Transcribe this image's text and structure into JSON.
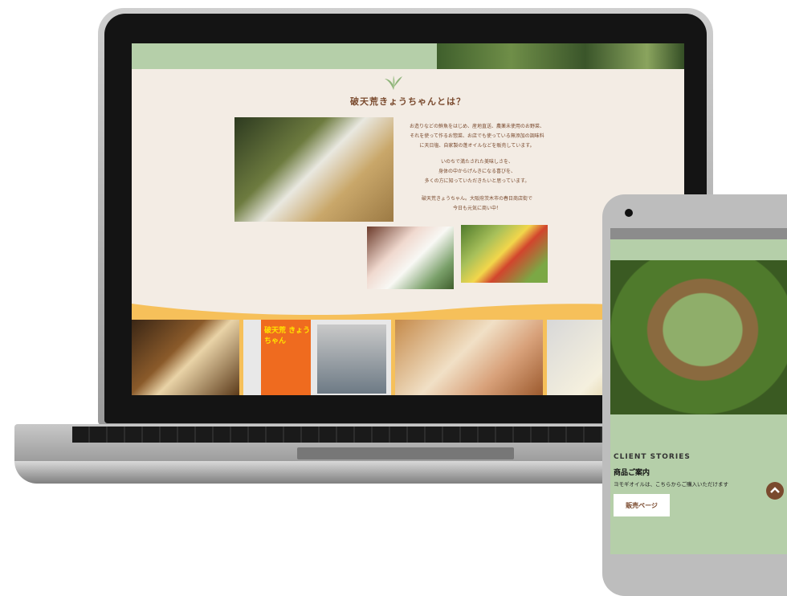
{
  "site": {
    "section_title": "破天荒きょうちゃんとは？",
    "intro": [
      "お造りなどの鮮魚をはじめ、産地直送、農薬未使用のお野菜、",
      "それを使って作るお惣菜、お店でも使っている無添加の調味料",
      "に天日塩、自家製の蓬オイルなどを販売しています。",
      "",
      "いのちで満たされた美味しさを、",
      "身体の中からげんきになる喜びを、",
      "多くの方に知っていただきたいと思っています。",
      "",
      "破天荒きょうちゃん。大阪府茨木市の春日商店街で",
      "今日も元気に商い中！"
    ],
    "sign_text": "破天荒 きょうちゃん"
  },
  "phone": {
    "section_label": "CLIENT STORIES",
    "title": "商品ご案内",
    "description": "ヨモギオイルは、こちらからご購入いただけます",
    "button_label": "販売ページ"
  },
  "icons": {
    "leaf": "leaf-icon",
    "scroll_top": "chevron-up-icon"
  },
  "colors": {
    "brand_brown": "#7a4a2e",
    "sage_green": "#b5cfa9",
    "cream": "#f3ece4",
    "orange": "#f6c05a"
  }
}
